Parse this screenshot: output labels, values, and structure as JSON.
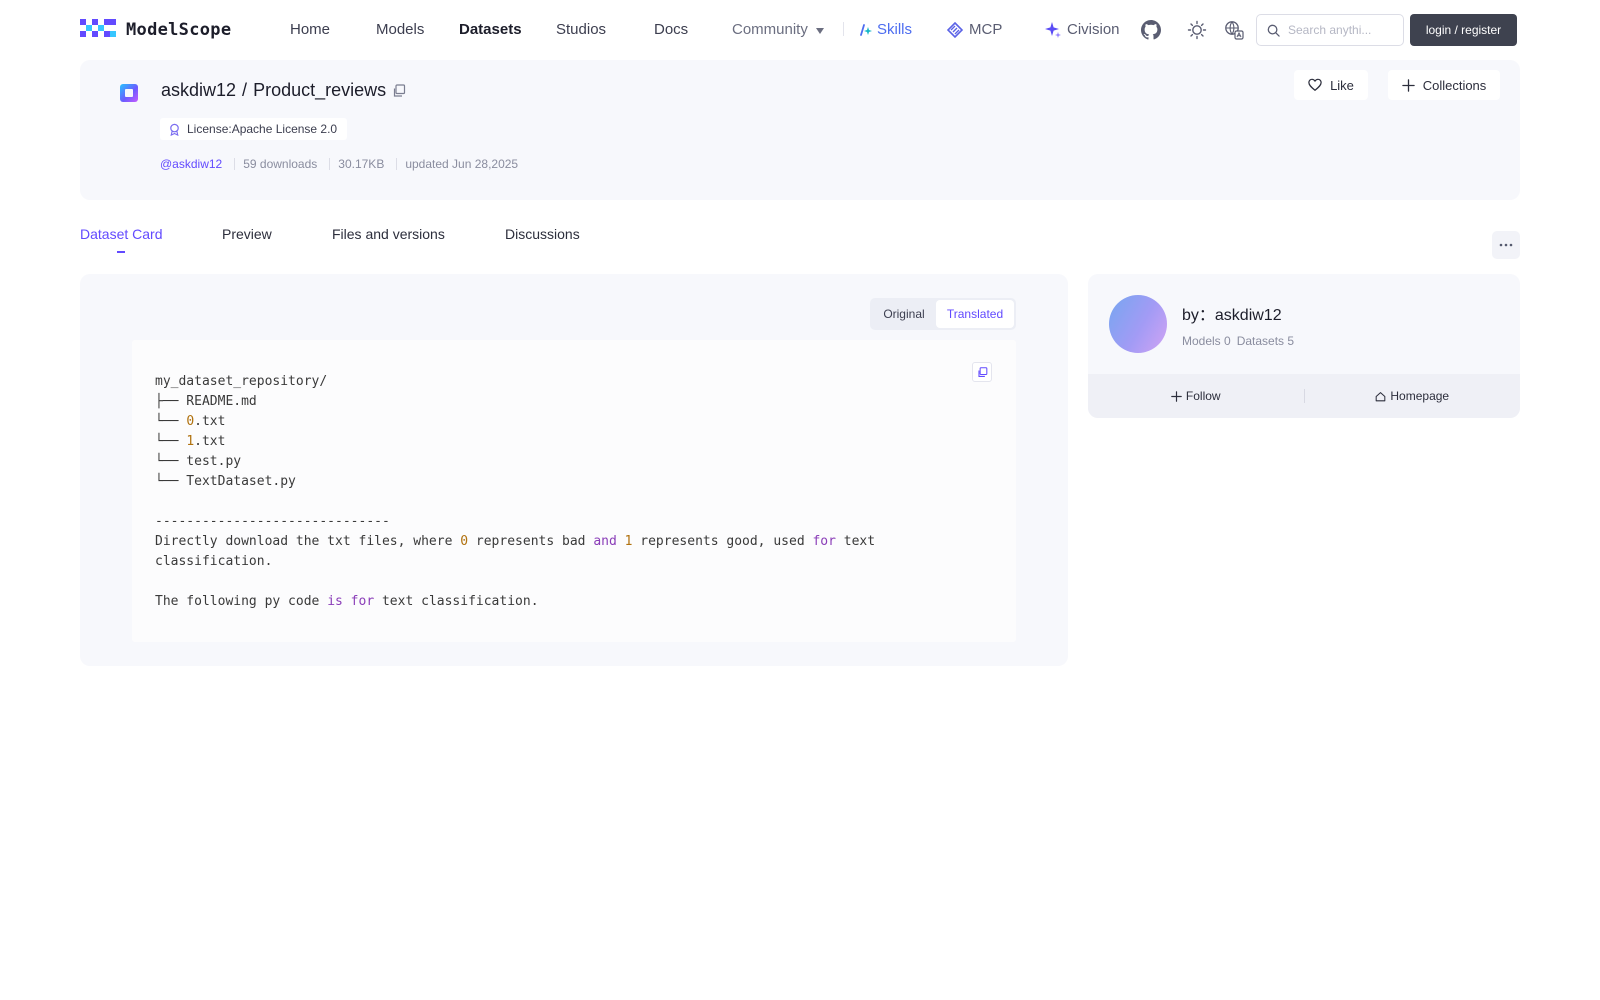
{
  "brand": {
    "name": "ModelScope"
  },
  "nav": {
    "home": "Home",
    "models": "Models",
    "datasets": "Datasets",
    "studios": "Studios",
    "docs": "Docs",
    "community": "Community",
    "skills": "Skills",
    "mcp": "MCP",
    "civision": "Civision",
    "active": "Datasets"
  },
  "search": {
    "placeholder": "Search anythi..."
  },
  "auth": {
    "login_label": "login / register"
  },
  "repo": {
    "owner": "askdiw12",
    "separator": "/",
    "name": "Product_reviews",
    "license": "License:Apache License 2.0",
    "owner_handle": "@askdiw12",
    "downloads": "59 downloads",
    "size": "30.17KB",
    "updated": "updated Jun 28,2025",
    "like_label": "Like",
    "collections_label": "Collections"
  },
  "tabs": [
    {
      "label": "Dataset Card",
      "active": true
    },
    {
      "label": "Preview",
      "active": false
    },
    {
      "label": "Files and versions",
      "active": false
    },
    {
      "label": "Discussions",
      "active": false
    }
  ],
  "card": {
    "toggle": {
      "original": "Original",
      "translated": "Translated",
      "selected": "Translated"
    },
    "code_lines": [
      [
        {
          "t": "my_dataset_repository/"
        }
      ],
      [
        {
          "t": "├── README.md"
        }
      ],
      [
        {
          "t": "└── "
        },
        {
          "t": "0",
          "c": "num"
        },
        {
          "t": ".txt"
        }
      ],
      [
        {
          "t": "└── "
        },
        {
          "t": "1",
          "c": "num"
        },
        {
          "t": ".txt"
        }
      ],
      [
        {
          "t": "└── test.py"
        }
      ],
      [
        {
          "t": "└── TextDataset.py"
        }
      ],
      [
        {
          "t": ""
        }
      ],
      [
        {
          "t": "------------------------------"
        }
      ],
      [
        {
          "t": "Directly download the txt files, where "
        },
        {
          "t": "0",
          "c": "num"
        },
        {
          "t": " represents bad "
        },
        {
          "t": "and",
          "c": "kw"
        },
        {
          "t": " "
        },
        {
          "t": "1",
          "c": "num"
        },
        {
          "t": " represents good, used "
        },
        {
          "t": "for",
          "c": "kw"
        },
        {
          "t": " text"
        }
      ],
      [
        {
          "t": "classification."
        }
      ],
      [
        {
          "t": ""
        }
      ],
      [
        {
          "t": "The following py code "
        },
        {
          "t": "is",
          "c": "kw"
        },
        {
          "t": " "
        },
        {
          "t": "for",
          "c": "kw"
        },
        {
          "t": " text classification."
        }
      ]
    ]
  },
  "author": {
    "by_label": "by：askdiw12",
    "models": "Models 0",
    "datasets": "Datasets 5",
    "follow_label": "Follow",
    "homepage_label": "Homepage"
  },
  "colors": {
    "accent": "#624aff",
    "skill": "#4d6df0",
    "code_number": "#b0710e",
    "code_keyword": "#8a3db8",
    "login_bg": "#3e424f",
    "card_bg": "#f7f8fc"
  },
  "icons": {
    "logo": "modelscope-logo-icon",
    "skills": "skills-icon",
    "mcp": "mcp-icon",
    "civision": "sparkle-icon",
    "github": "github-icon",
    "theme": "sun-icon",
    "language": "translate-icon",
    "search": "search-icon",
    "copy": "copy-icon",
    "license": "badge-icon",
    "like": "heart-icon",
    "collections": "plus-icon",
    "more": "ellipsis-icon",
    "follow": "plus-icon",
    "homepage": "home-icon"
  }
}
